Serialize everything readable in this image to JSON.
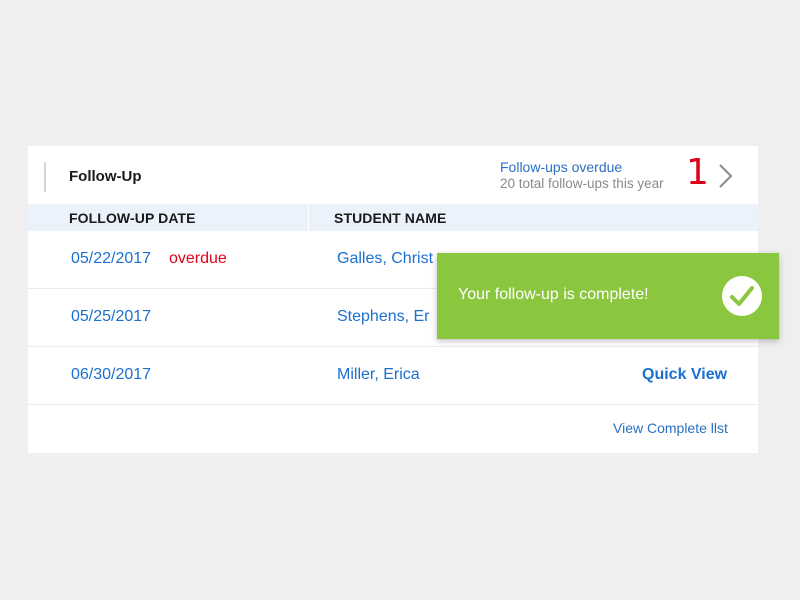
{
  "panel": {
    "title": "Follow-Up",
    "overdue_label": "Follow-ups overdue",
    "total_label": "20 total follow-ups this year",
    "overdue_count": "1"
  },
  "table": {
    "columns": [
      "FOLLOW-UP DATE",
      "STUDENT NAME"
    ],
    "rows": [
      {
        "date": "05/22/2017",
        "status": "overdue",
        "student": "Galles, Christ",
        "action": ""
      },
      {
        "date": "05/25/2017",
        "status": "",
        "student": "Stephens, Er",
        "action": ""
      },
      {
        "date": "06/30/2017",
        "status": "",
        "student": "Miller, Erica",
        "action": "Quick View"
      }
    ],
    "footer_link": "View Complete llst"
  },
  "toast": {
    "message": "Your follow-up is complete!",
    "icon": "checkmark-icon"
  },
  "colors": {
    "accent_blue": "#1a6fd0",
    "overdue_red": "#e0001b",
    "toast_green": "#8bc63f",
    "header_bg": "#ebf2fc"
  }
}
